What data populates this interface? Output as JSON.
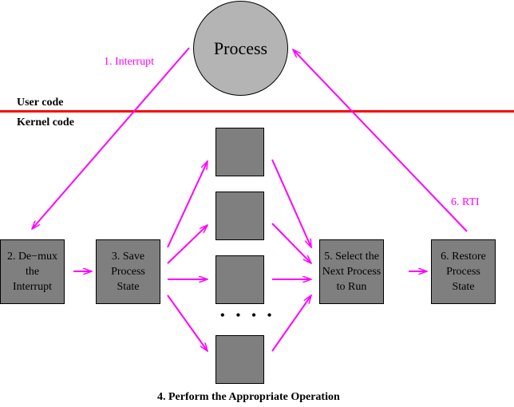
{
  "process": {
    "label": "Process"
  },
  "regions": {
    "user": "User code",
    "kernel": "Kernel code"
  },
  "edges": {
    "interrupt": "1. Interrupt",
    "rti": "6. RTI"
  },
  "steps": [
    {
      "id": "demux",
      "label": "2. De−mux\nthe\nInterrupt"
    },
    {
      "id": "save",
      "label": "3. Save\nProcess\nState"
    },
    {
      "id": "select",
      "label": "5. Select the\nNext Process\nto Run"
    },
    {
      "id": "restore",
      "label": "6. Restore\nProcess\nState"
    }
  ],
  "operations": {
    "caption": "4. Perform the Appropriate Operation",
    "ellipsis": "• • • •",
    "count_boxes": 4
  },
  "colors": {
    "arrow": "#ff00ff",
    "divider": "#ff0000",
    "box": "#7f7f7f",
    "circle": "#b4b4b4"
  }
}
